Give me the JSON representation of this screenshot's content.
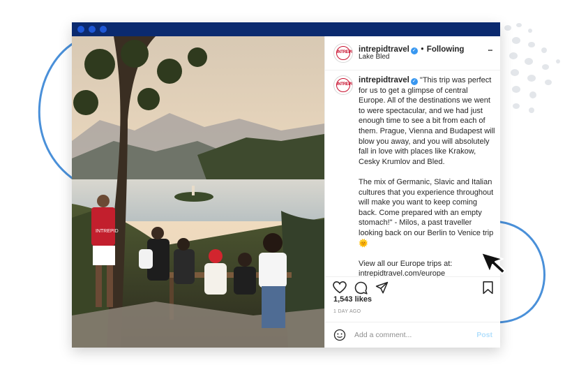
{
  "post": {
    "username": "intrepidtravel",
    "avatar_text": "INTREPID",
    "dot": "•",
    "follow_status": "Following",
    "location": "Lake Bled",
    "more_icon": "more-horizontal-icon",
    "more_glyph": "•••",
    "verified_glyph": "✓",
    "caption_paragraphs": [
      "\"This trip was perfect for us to get a glimpse of central Europe. All of the destinations we went to were spectacular, and we had just enough time to see a bit from each of them. Prague, Vienna and Budapest will blow you away, and you will absolutely fall in love with places like Krakow, Cesky Krumlov and Bled.",
      "The mix of Germanic, Slavic and Italian cultures that you experience throughout will make you want to keep coming back. Come prepared with an empty stomach!\" - Milos, a past traveller looking back on our Berlin to Venice trip 🌞",
      "View all our Europe trips at: intrepidtravel.com/europe"
    ],
    "likes": "1,543 likes",
    "time_ago": "1 DAY AGO",
    "comment_placeholder": "Add a comment...",
    "post_label": "Post",
    "shirt_text": "INTREPID"
  },
  "colors": {
    "titlebar": "#0b2a6f",
    "accent_blue": "#3897f0",
    "brand_red": "#c8102e",
    "post_disabled": "#b2dffc"
  }
}
